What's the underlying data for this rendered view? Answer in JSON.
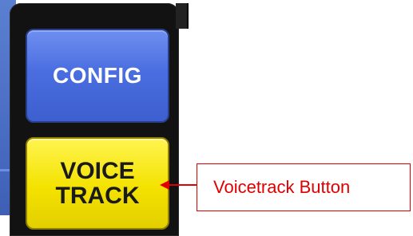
{
  "buttons": {
    "config_label": "CONFIG",
    "voice_track_line1": "VOICE",
    "voice_track_line2": "TRACK"
  },
  "annotation": {
    "label": "Voicetrack Button"
  },
  "colors": {
    "config_button": "#4a6ee0",
    "voice_track_button": "#f3e200",
    "panel": "#121212",
    "annotation": "#e00000"
  }
}
